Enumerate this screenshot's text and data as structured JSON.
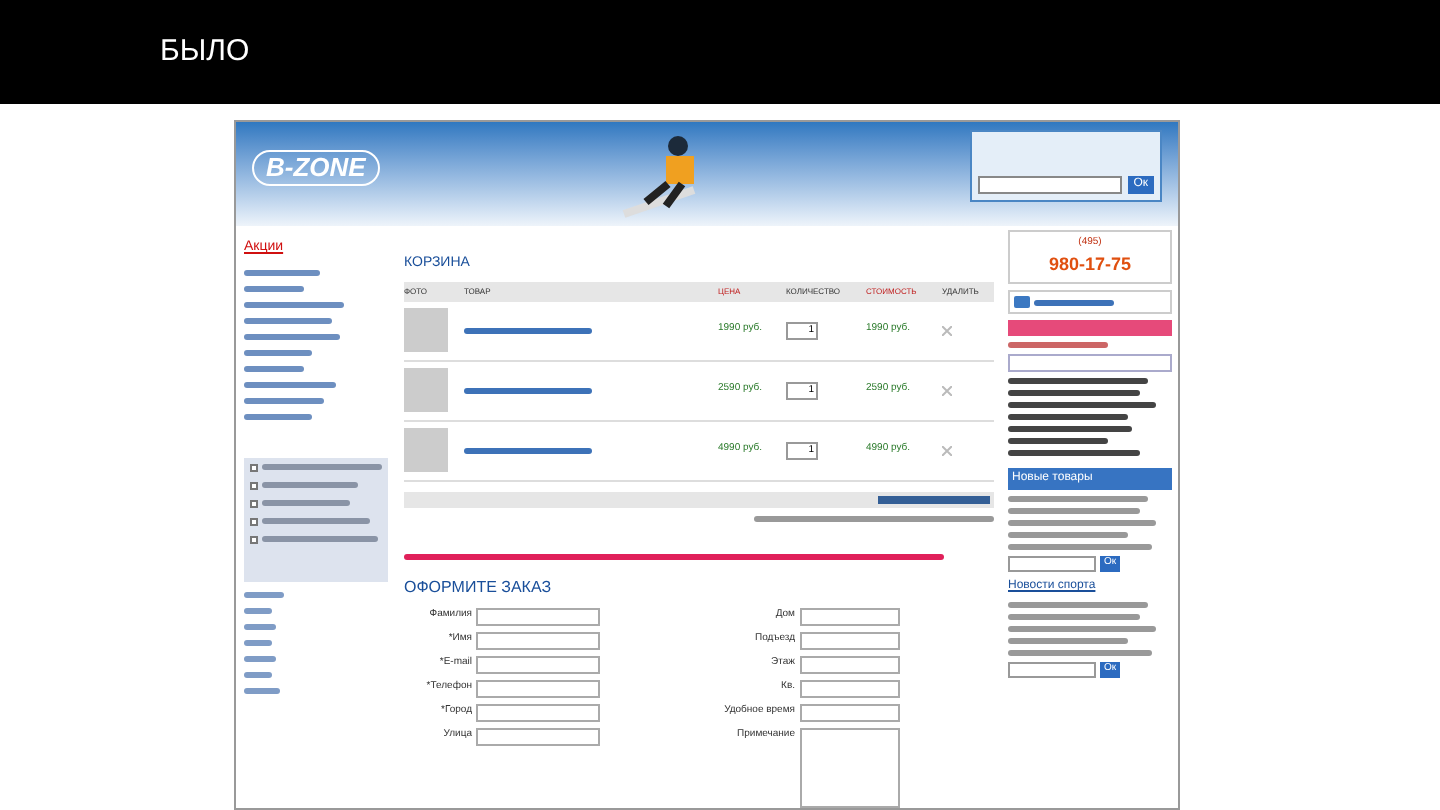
{
  "slide": {
    "title": "БЫЛО"
  },
  "site": {
    "logo": "B-ZONE",
    "phone_code": "(495)",
    "phone": "980-17-75",
    "search_button": "Ок"
  },
  "sidebar": {
    "items": [
      {
        "label": "Акции",
        "selected": true
      }
    ],
    "poll": [
      {
        "checked": false
      },
      {
        "checked": false
      },
      {
        "checked": false
      },
      {
        "checked": false
      },
      {
        "checked": false
      }
    ]
  },
  "cart": {
    "title": "КОРЗИНА",
    "columns": [
      "ФОТО",
      "ТОВАР",
      "ЦЕНА",
      "КОЛИЧЕСТВО",
      "СТОИМОСТЬ",
      "УДАЛИТЬ"
    ],
    "rows": [
      {
        "price": "1990 руб.",
        "quantity": "1",
        "total": "1990 руб."
      },
      {
        "price": "2590 руб.",
        "quantity": "1",
        "total": "2590 руб."
      },
      {
        "price": "4990 руб.",
        "quantity": "1",
        "total": "4990 руб."
      }
    ]
  },
  "order": {
    "title": "ОФОРМИТЕ ЗАКАЗ",
    "left_fields": [
      "Фамилия",
      "*Имя",
      "*E-mail",
      "*Телефон",
      "*Город",
      "Улица"
    ],
    "right_fields": [
      "Дом",
      "Подъезд",
      "Этаж",
      "Кв.",
      "Удобное время",
      "Примечание"
    ]
  },
  "right_column": {
    "new_goods": "Новые товары",
    "sport_news": "Новости спорта",
    "ok_buttons": [
      "Ок",
      "Ок"
    ]
  }
}
